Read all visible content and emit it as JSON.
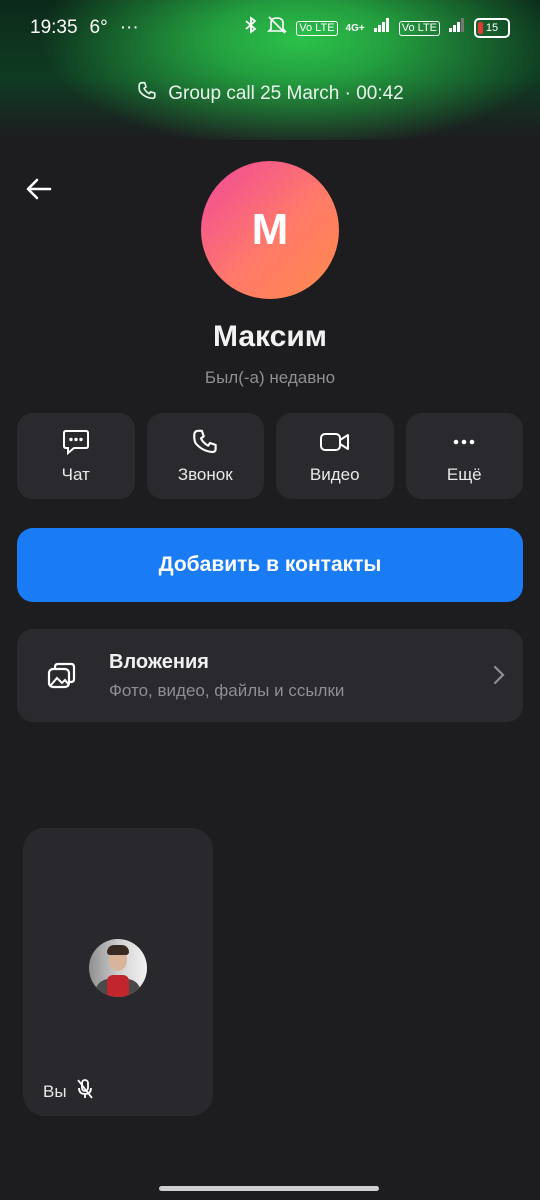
{
  "status_bar": {
    "time": "19:35",
    "temp": "6°",
    "dots": "···",
    "volte1": "Vo LTE",
    "net": "4G+",
    "volte2": "Vo LTE",
    "battery": "15"
  },
  "call_banner": {
    "text": "Group call 25 March · 00:42"
  },
  "profile": {
    "initial": "M",
    "name": "Максим",
    "status": "Был(-а) недавно",
    "avatar_gradient": [
      "#f0489a",
      "#ff8a4a"
    ]
  },
  "actions": [
    {
      "label": "Чат",
      "icon": "chat-icon"
    },
    {
      "label": "Звонок",
      "icon": "phone-icon"
    },
    {
      "label": "Видео",
      "icon": "video-icon"
    },
    {
      "label": "Ещё",
      "icon": "more-icon"
    }
  ],
  "add_contact": {
    "label": "Добавить в контакты",
    "color": "#1a7cf5"
  },
  "attachments": {
    "title": "Вложения",
    "subtitle": "Фото, видео, файлы и ссылки"
  },
  "self_tile": {
    "label": "Вы",
    "mic": "mic-off-icon"
  }
}
